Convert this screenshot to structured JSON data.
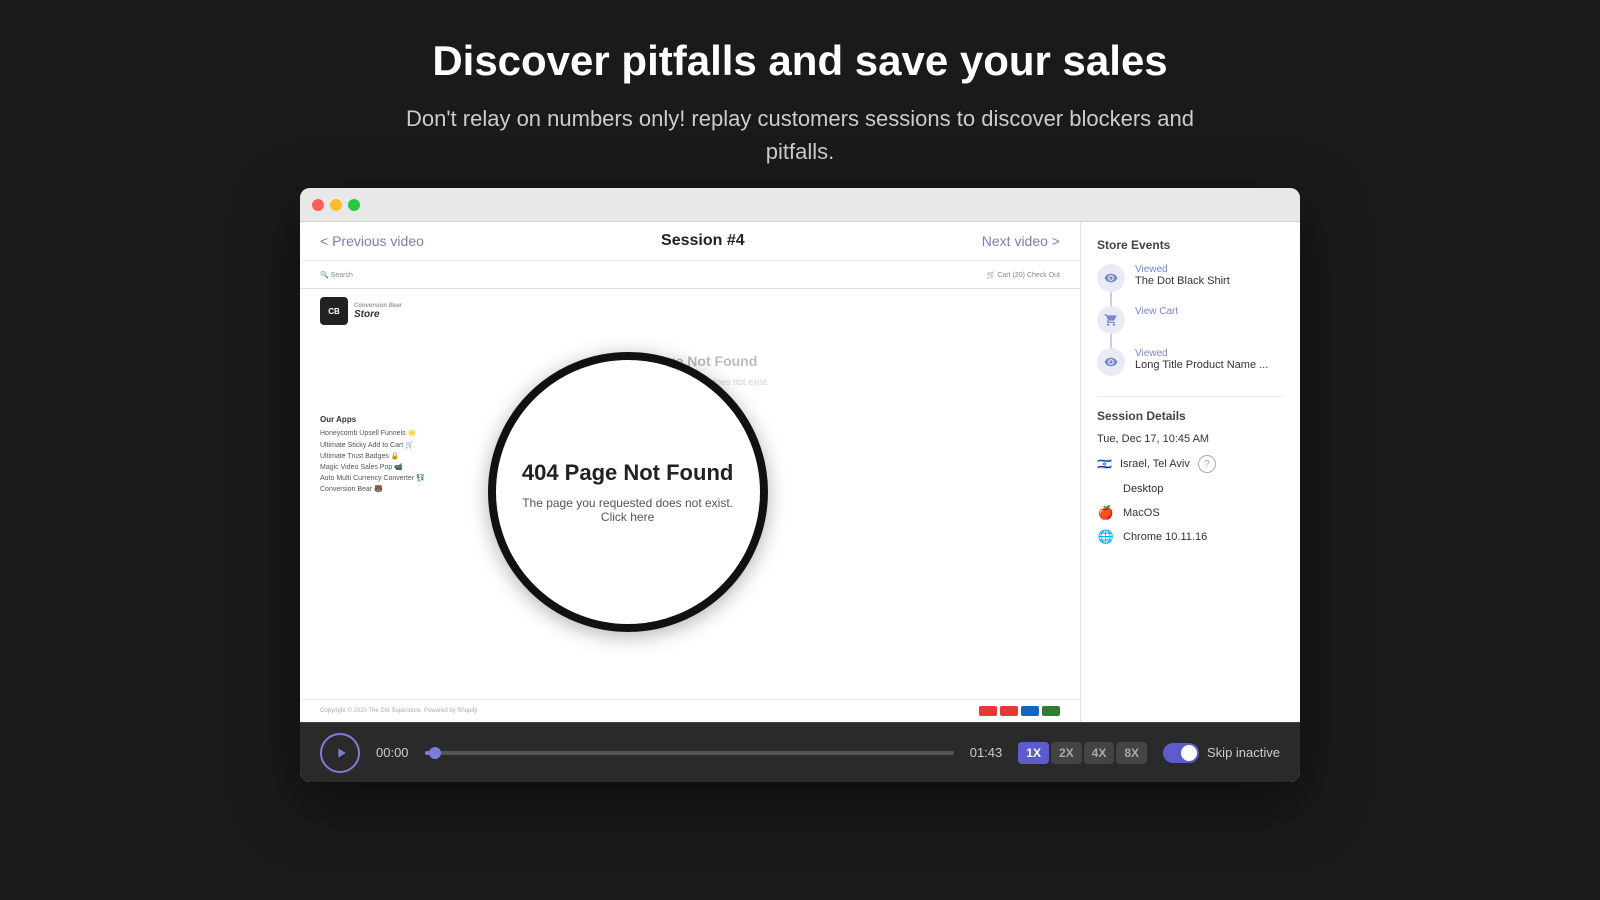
{
  "page": {
    "title": "Discover pitfalls and save your sales",
    "subtitle": "Don't relay on numbers only! replay customers sessions to discover blockers and pitfalls."
  },
  "browser": {
    "dots": [
      "red",
      "yellow",
      "green"
    ]
  },
  "session": {
    "prev_label": "< Previous video",
    "next_label": "Next video >",
    "title": "Session #4"
  },
  "store_page": {
    "search_label": "🔍 Search",
    "cart_label": "🛒 Cart (20)   Check Out",
    "logo_text": "Store",
    "logo_subtext": "Conversion Bear",
    "not_found_title": "404 Page Not Found",
    "not_found_text": "The page you requested does not exist. Click here",
    "our_apps_title": "Our Apps",
    "apps": [
      "Honeycomb Upsell Funnels 🌟",
      "Ultimate Sticky Add to Cart 🛒",
      "Ultimate Trust Badges 🔒",
      "Magic Video Sales Pop 📹",
      "Auto Multi Currency Converter 💱",
      "Conversion Bear 🐻"
    ],
    "footer_text": "Copyright © 2020 The Dot Superstore. Powered by Shopify"
  },
  "store_events": {
    "title": "Store Events",
    "events": [
      {
        "type": "viewed",
        "label": "Viewed",
        "name": "The Dot Black Shirt"
      },
      {
        "type": "cart",
        "label": "View Cart",
        "name": ""
      },
      {
        "type": "viewed",
        "label": "Viewed",
        "name": "Long Title Product Name ..."
      }
    ]
  },
  "session_details": {
    "title": "Session Details",
    "datetime": "Tue, Dec 17, 10:45 AM",
    "location": "Israel, Tel Aviv",
    "device": "Desktop",
    "os": "MacOS",
    "browser": "Chrome 10.11.16"
  },
  "controls": {
    "time_current": "00:00",
    "time_total": "01:43",
    "speed_options": [
      "1X",
      "2X",
      "4X",
      "8X"
    ],
    "active_speed": "1X",
    "skip_label": "Skip inactive",
    "progress_percent": 2
  }
}
